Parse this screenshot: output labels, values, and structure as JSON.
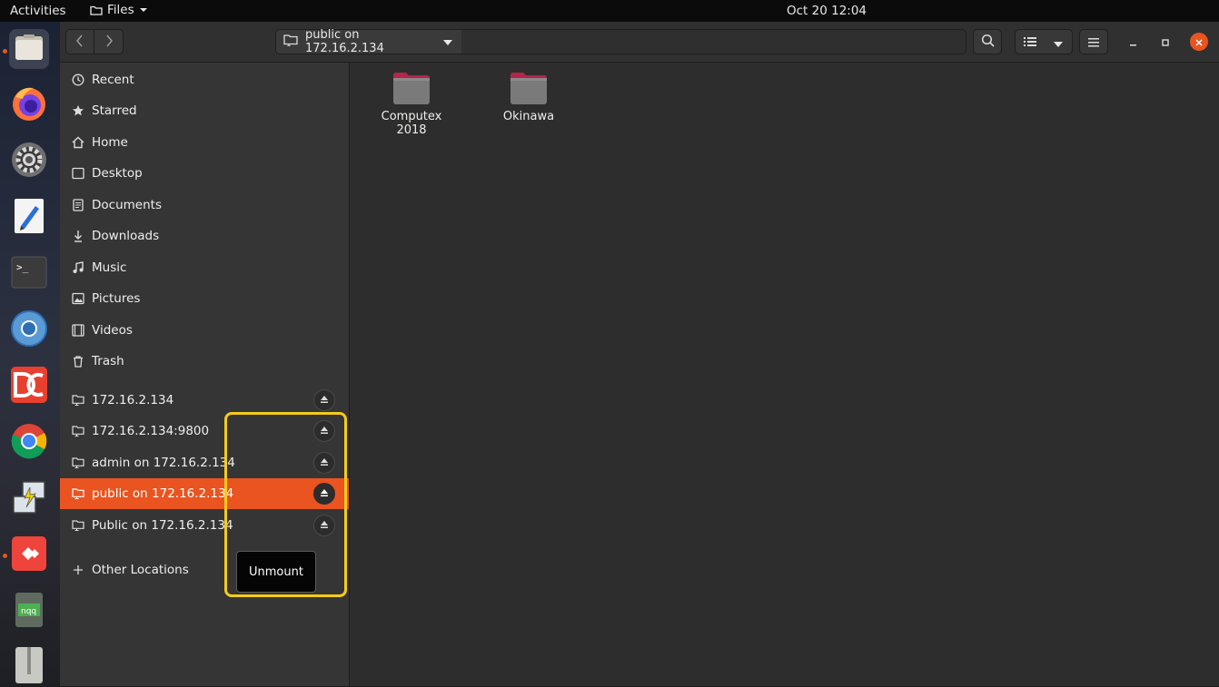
{
  "topbar": {
    "activities": "Activities",
    "app_menu": "Files",
    "clock": "Oct 20  12:04"
  },
  "dock": {
    "items": [
      {
        "name": "files-icon",
        "active": true,
        "running": true
      },
      {
        "name": "firefox-icon"
      },
      {
        "name": "settings-icon"
      },
      {
        "name": "text-editor-icon"
      },
      {
        "name": "terminal-icon"
      },
      {
        "name": "chromium-icon"
      },
      {
        "name": "double-commander-icon"
      },
      {
        "name": "chrome-icon"
      },
      {
        "name": "remote-desktop-icon"
      },
      {
        "name": "anydesk-icon",
        "running": true
      },
      {
        "name": "notes-icon",
        "label": "nqq"
      },
      {
        "name": "archive-manager-icon"
      }
    ]
  },
  "headerbar": {
    "path_label": "public on 172.16.2.134"
  },
  "sidebar": {
    "places": [
      {
        "label": "Recent",
        "icon": "clock-icon"
      },
      {
        "label": "Starred",
        "icon": "star-icon"
      },
      {
        "label": "Home",
        "icon": "home-icon"
      },
      {
        "label": "Desktop",
        "icon": "desktop-icon"
      },
      {
        "label": "Documents",
        "icon": "document-icon"
      },
      {
        "label": "Downloads",
        "icon": "download-icon"
      },
      {
        "label": "Music",
        "icon": "music-icon"
      },
      {
        "label": "Pictures",
        "icon": "picture-icon"
      },
      {
        "label": "Videos",
        "icon": "video-icon"
      },
      {
        "label": "Trash",
        "icon": "trash-icon"
      }
    ],
    "network": [
      {
        "label": "172.16.2.134"
      },
      {
        "label": "172.16.2.134:9800"
      },
      {
        "label": "admin on 172.16.2.134"
      },
      {
        "label": "public on 172.16.2.134",
        "selected": true
      },
      {
        "label": "Public on 172.16.2.134"
      }
    ],
    "other_locations": "Other Locations",
    "tooltip": "Unmount"
  },
  "files": [
    {
      "name": "Computex\n2018",
      "line1": "Computex",
      "line2": "2018"
    },
    {
      "name": "Okinawa",
      "line1": "Okinawa",
      "line2": ""
    }
  ],
  "colors": {
    "accent": "#e95420",
    "highlight_box": "#f5cb1b"
  }
}
